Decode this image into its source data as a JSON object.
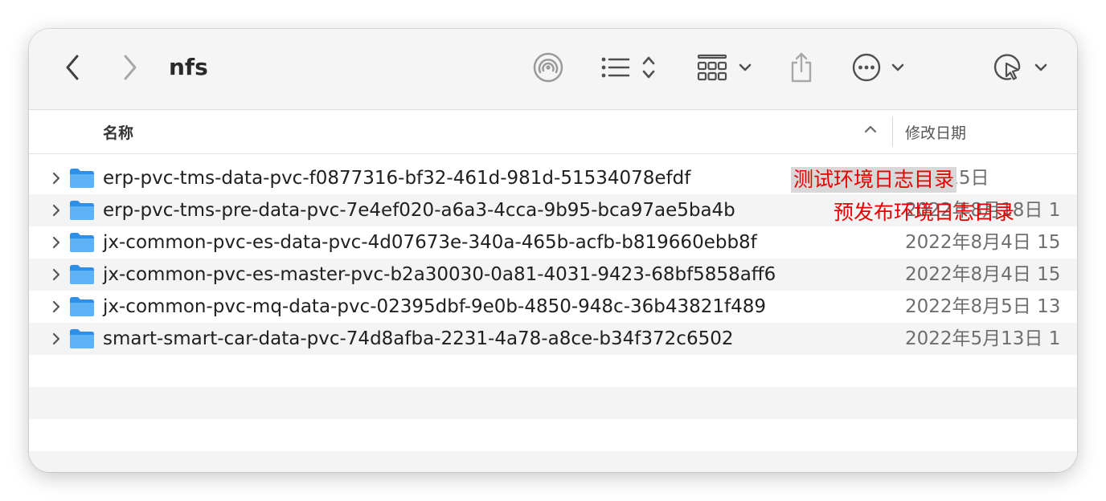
{
  "toolbar": {
    "title": "nfs",
    "icons": [
      "chevron-left-icon",
      "chevron-right-icon",
      "airdrop-icon",
      "list-view-icon",
      "sort-updown-icon",
      "grid-view-icon",
      "chevron-down-icon",
      "share-icon",
      "more-icon",
      "chevron-down-icon",
      "markup-icon",
      "chevron-down-icon"
    ]
  },
  "header": {
    "name_label": "名称",
    "date_label": "修改日期"
  },
  "rows": [
    {
      "name": "erp-pvc-tms-data-pvc-f0877316-bf32-461d-981d-51534078efdf",
      "date": "12月15日"
    },
    {
      "name": "erp-pvc-tms-pre-data-pvc-7e4ef020-a6a3-4cca-9b95-bca97ae5ba4b",
      "date": "2022年8月18日 1"
    },
    {
      "name": "jx-common-pvc-es-data-pvc-4d07673e-340a-465b-acfb-b819660ebb8f",
      "date": "2022年8月4日 15"
    },
    {
      "name": "jx-common-pvc-es-master-pvc-b2a30030-0a81-4031-9423-68bf5858aff6",
      "date": "2022年8月4日 15"
    },
    {
      "name": "jx-common-pvc-mq-data-pvc-02395dbf-9e0b-4850-948c-36b43821f489",
      "date": "2022年8月5日 13"
    },
    {
      "name": "smart-smart-car-data-pvc-74d8afba-2231-4a78-a8ce-b34f372c6502",
      "date": "2022年5月13日 1"
    }
  ],
  "annotations": {
    "test_env": "测试环境日志目录",
    "pre_env": "预发布环境日志目录"
  },
  "colors": {
    "folder": "#3d9ff0",
    "annotation": "#e60000",
    "stripe": "#f4f4f4"
  }
}
